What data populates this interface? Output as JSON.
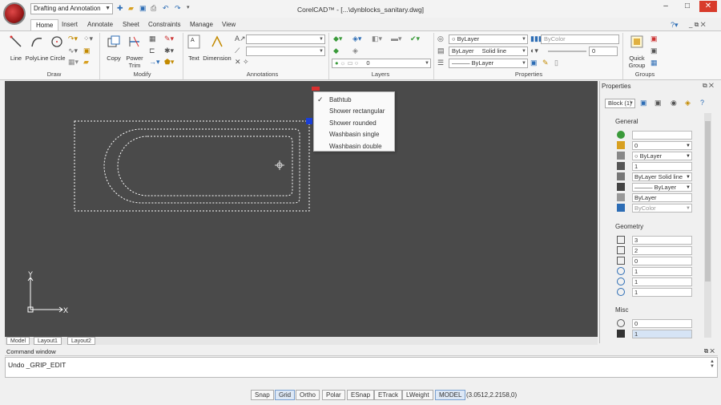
{
  "app": {
    "title": "CorelCAD™ - [...\\dynblocks_sanitary.dwg]",
    "workspace": "Drafting and Annotation"
  },
  "tabs": [
    "Home",
    "Insert",
    "Annotate",
    "Sheet",
    "Constraints",
    "Manage",
    "View"
  ],
  "ribbon": {
    "groups": [
      "Draw",
      "Modify",
      "Annotations",
      "Layers",
      "Properties",
      "Groups"
    ],
    "draw_tools": [
      "Line",
      "PolyLine",
      "Circle"
    ],
    "modify_tools": [
      "Copy",
      "Power Trim"
    ],
    "annotation_tools": [
      "Text",
      "Dimension"
    ],
    "group_tools": [
      "Quick Group"
    ],
    "layer_value": "0",
    "color_value": "ByLayer",
    "linestyle_layer": "ByLayer",
    "linestyle_value": "Solid line",
    "lineweight_value": "ByLayer",
    "bycolor_value": "ByColor",
    "transparency_value": "0"
  },
  "context_menu": {
    "items": [
      "Bathtub",
      "Shower rectangular",
      "Shower rounded",
      "Washbasin single",
      "Washbasin double"
    ],
    "checked": "Bathtub"
  },
  "layout_tabs": [
    "Model",
    "Layout1",
    "Layout2"
  ],
  "axis": {
    "x": "X",
    "y": "Y"
  },
  "properties": {
    "title": "Properties",
    "selector": "Block (1)",
    "general_label": "General",
    "general": [
      "",
      "0",
      "ByLayer",
      "1",
      "ByLayer      Solid line",
      "ByLayer",
      "ByLayer",
      "ByColor"
    ],
    "geometry_label": "Geometry",
    "geometry": [
      "3",
      "2",
      "0",
      "1",
      "1",
      "1"
    ],
    "misc_label": "Misc",
    "misc": [
      "0",
      "1"
    ]
  },
  "command": {
    "title": "Command window",
    "line": "Undo _GRIP_EDIT"
  },
  "status": {
    "buttons": [
      "Snap",
      "Grid",
      "Ortho",
      "Polar",
      "ESnap",
      "ETrack",
      "LWeight",
      "MODEL"
    ],
    "active": [
      "Grid",
      "MODEL"
    ],
    "coords": "(3.0512,2.2158,0)"
  }
}
